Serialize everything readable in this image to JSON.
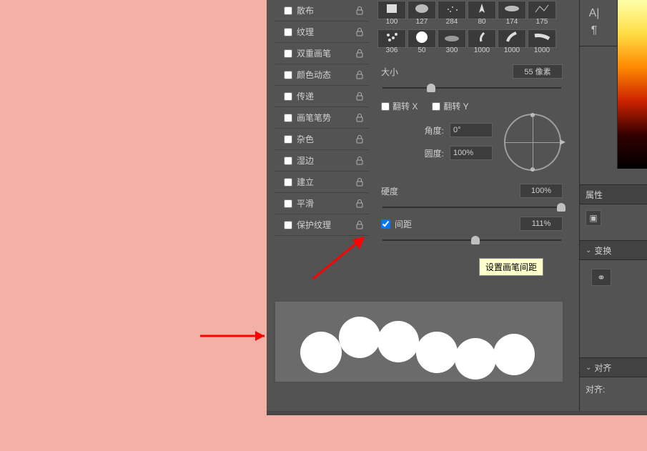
{
  "options": [
    {
      "label": "散布",
      "checked": false
    },
    {
      "label": "纹理",
      "checked": false
    },
    {
      "label": "双重画笔",
      "checked": false
    },
    {
      "label": "颜色动态",
      "checked": false
    },
    {
      "label": "传递",
      "checked": false
    },
    {
      "label": "画笔笔势",
      "checked": false
    },
    {
      "label": "杂色",
      "checked": false
    },
    {
      "label": "湿边",
      "checked": false
    },
    {
      "label": "建立",
      "checked": false
    },
    {
      "label": "平滑",
      "checked": false
    },
    {
      "label": "保护纹理",
      "checked": false
    }
  ],
  "brushes_row1": [
    "100",
    "127",
    "284",
    "80",
    "174",
    "175"
  ],
  "brushes_row2": [
    "306",
    "50",
    "300",
    "1000",
    "1000",
    "1000"
  ],
  "size": {
    "label": "大小",
    "value": "55 像素"
  },
  "flip_x": {
    "label": "翻转 X",
    "checked": false
  },
  "flip_y": {
    "label": "翻转 Y",
    "checked": false
  },
  "angle": {
    "label": "角度:",
    "value": "0°"
  },
  "roundness": {
    "label": "圆度:",
    "value": "100%"
  },
  "hardness": {
    "label": "硬度",
    "value": "100%"
  },
  "spacing": {
    "label": "间距",
    "value": "111%",
    "checked": true
  },
  "tooltip": "设置画笔间距",
  "panels": {
    "properties": "属性",
    "transform": "变换",
    "align": "对齐",
    "align_label": "对齐:"
  }
}
